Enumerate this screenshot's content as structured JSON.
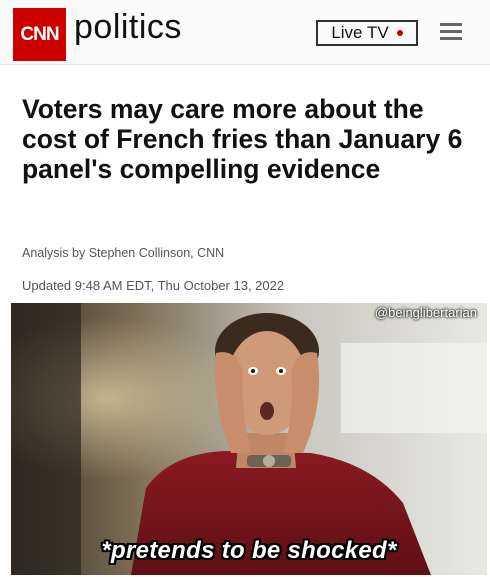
{
  "header": {
    "logo_text": "CNN",
    "section": "politics",
    "live_tv_label": "Live TV",
    "brand_color": "#cc0000",
    "menu_icon": "hamburger-menu-icon"
  },
  "article": {
    "headline": "Voters may care more about the cost of French fries than January 6 panel's compelling evidence",
    "byline": "Analysis by Stephen Collinson, CNN",
    "updated": "Updated 9:48 AM EDT, Thu October 13, 2022"
  },
  "meme": {
    "watermark": "@beinglibertarian",
    "caption": "*pretends to be shocked*"
  }
}
